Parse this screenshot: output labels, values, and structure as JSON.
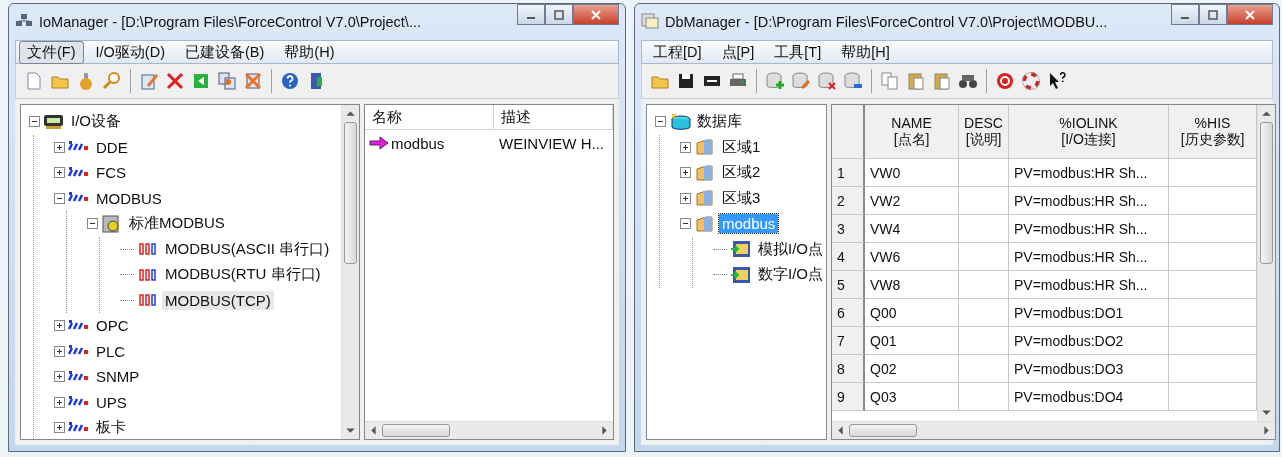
{
  "io_manager": {
    "title": "IoManager - [D:\\Program Files\\ForceControl V7.0\\Project\\...",
    "menu": [
      {
        "label": "文件(F)",
        "selected": true
      },
      {
        "label": "I/O驱动(D)",
        "selected": false
      },
      {
        "label": "已建设备(B)",
        "selected": false
      },
      {
        "label": "帮助(H)",
        "selected": false
      }
    ],
    "tree": [
      {
        "label": "I/O设备",
        "kind": "board",
        "expanded": true,
        "selected": false,
        "children": [
          {
            "label": "DDE",
            "kind": "driver",
            "expanded": false,
            "selected": false
          },
          {
            "label": "FCS",
            "kind": "driver",
            "expanded": false,
            "selected": false
          },
          {
            "label": "MODBUS",
            "kind": "driver",
            "expanded": true,
            "selected": false,
            "children": [
              {
                "label": "标准MODBUS",
                "kind": "device",
                "expanded": true,
                "selected": false,
                "children": [
                  {
                    "label": "MODBUS(ASCII 串行口)",
                    "kind": "protocol",
                    "selected": false
                  },
                  {
                    "label": "MODBUS(RTU 串行口)",
                    "kind": "protocol",
                    "selected": false
                  },
                  {
                    "label": "MODBUS(TCP)",
                    "kind": "protocol",
                    "selected": true
                  }
                ]
              }
            ]
          },
          {
            "label": "OPC",
            "kind": "driver",
            "expanded": false,
            "selected": false
          },
          {
            "label": "PLC",
            "kind": "driver",
            "expanded": false,
            "selected": false
          },
          {
            "label": "SNMP",
            "kind": "driver",
            "expanded": false,
            "selected": false
          },
          {
            "label": "UPS",
            "kind": "driver",
            "expanded": false,
            "selected": false
          },
          {
            "label": "板卡",
            "kind": "driver",
            "expanded": false,
            "selected": false
          }
        ]
      }
    ],
    "list": {
      "columns": [
        "名称",
        "描述"
      ],
      "rows": [
        {
          "name": "modbus",
          "description": "WEINVIEW H..."
        }
      ]
    }
  },
  "db_manager": {
    "title": "DbManager - [D:\\Program Files\\ForceControl V7.0\\Project\\MODBU...",
    "menu": [
      {
        "label": "工程[D]",
        "selected": false
      },
      {
        "label": "点[P]",
        "selected": false
      },
      {
        "label": "工具[T]",
        "selected": false
      },
      {
        "label": "帮助[H]",
        "selected": false
      }
    ],
    "tree": [
      {
        "label": "数据库",
        "kind": "database",
        "expanded": true,
        "selected": false,
        "children": [
          {
            "label": "区域1",
            "kind": "area",
            "expanded": false,
            "selected": false
          },
          {
            "label": "区域2",
            "kind": "area",
            "expanded": false,
            "selected": false
          },
          {
            "label": "区域3",
            "kind": "area",
            "expanded": false,
            "selected": false
          },
          {
            "label": "modbus",
            "kind": "area",
            "expanded": true,
            "selected": true,
            "children": [
              {
                "label": "模拟I/O点",
                "kind": "points",
                "selected": false
              },
              {
                "label": "数字I/O点",
                "kind": "points",
                "selected": false
              }
            ]
          }
        ]
      }
    ],
    "table": {
      "columns": [
        {
          "title": "NAME",
          "subtitle": "[点名]"
        },
        {
          "title": "DESC",
          "subtitle": "[说明]"
        },
        {
          "title": "%IOLINK",
          "subtitle": "[I/O连接]"
        },
        {
          "title": "%HIS",
          "subtitle": "[历史参数]"
        }
      ],
      "rows": [
        {
          "index": "1",
          "name": "VW0",
          "iolink": "PV=modbus:HR Sh..."
        },
        {
          "index": "2",
          "name": "VW2",
          "iolink": "PV=modbus:HR Sh..."
        },
        {
          "index": "3",
          "name": "VW4",
          "iolink": "PV=modbus:HR Sh..."
        },
        {
          "index": "4",
          "name": "VW6",
          "iolink": "PV=modbus:HR Sh..."
        },
        {
          "index": "5",
          "name": "VW8",
          "iolink": "PV=modbus:HR Sh..."
        },
        {
          "index": "6",
          "name": "Q00",
          "iolink": "PV=modbus:DO1"
        },
        {
          "index": "7",
          "name": "Q01",
          "iolink": "PV=modbus:DO2"
        },
        {
          "index": "8",
          "name": "Q02",
          "iolink": "PV=modbus:DO3"
        },
        {
          "index": "9",
          "name": "Q03",
          "iolink": "PV=modbus:DO4"
        }
      ]
    }
  }
}
